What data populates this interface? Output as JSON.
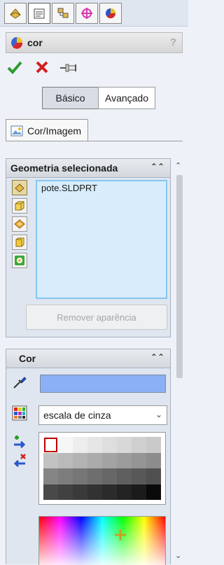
{
  "panel": {
    "title": "cor",
    "help": "?"
  },
  "tabs": [
    {
      "icon": "feature-manager-icon"
    },
    {
      "icon": "property-manager-icon"
    },
    {
      "icon": "configuration-manager-icon"
    },
    {
      "icon": "dimxpert-icon"
    },
    {
      "icon": "display-manager-icon"
    }
  ],
  "modes": {
    "basic": "Básico",
    "advanced": "Avançado"
  },
  "page_tab": {
    "label": "Cor/Imagem"
  },
  "geometry": {
    "title": "Geometria selecionada",
    "items": [
      "pote.SLDPRT"
    ],
    "remove_label": "Remover aparência"
  },
  "color": {
    "title": "Cor",
    "swatch": "#8cb0f5",
    "mode_select": "escala de cinza"
  },
  "colors": {
    "accent": "#86c6f0",
    "listbox_bg": "#d8ecfb",
    "panel_bg": "#eef2f8"
  }
}
